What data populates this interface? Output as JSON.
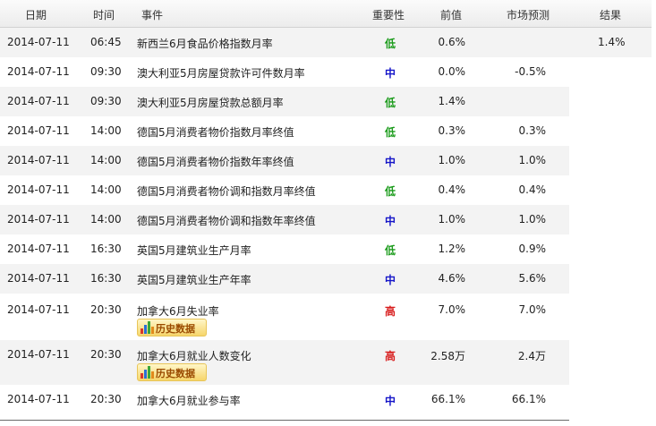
{
  "header": {
    "date": "日期",
    "time": "时间",
    "event": "事件",
    "importance": "重要性",
    "previous": "前值",
    "forecast": "市场预测",
    "result": "结果"
  },
  "history_button_label": "历史数据",
  "importance_colors": {
    "低": "#1b9b1b",
    "中": "#1515c8",
    "高": "#d81e1e"
  },
  "rows": [
    {
      "date": "2014-07-11",
      "time": "06:45",
      "event": "新西兰6月食品价格指数月率",
      "importance": "低",
      "previous": "0.6%",
      "forecast": "",
      "result": "1.4%"
    },
    {
      "date": "2014-07-11",
      "time": "09:30",
      "event": "澳大利亚5月房屋贷款许可件数月率",
      "importance": "中",
      "previous": "0.0%",
      "forecast": "-0.5%"
    },
    {
      "date": "2014-07-11",
      "time": "09:30",
      "event": "澳大利亚5月房屋贷款总额月率",
      "importance": "低",
      "previous": "1.4%",
      "forecast": ""
    },
    {
      "date": "2014-07-11",
      "time": "14:00",
      "event": "德国5月消费者物价指数月率终值",
      "importance": "低",
      "previous": "0.3%",
      "forecast": "0.3%"
    },
    {
      "date": "2014-07-11",
      "time": "14:00",
      "event": "德国5月消费者物价指数年率终值",
      "importance": "中",
      "previous": "1.0%",
      "forecast": "1.0%"
    },
    {
      "date": "2014-07-11",
      "time": "14:00",
      "event": "德国5月消费者物价调和指数月率终值",
      "importance": "低",
      "previous": "0.4%",
      "forecast": "0.4%"
    },
    {
      "date": "2014-07-11",
      "time": "14:00",
      "event": "德国5月消费者物价调和指数年率终值",
      "importance": "中",
      "previous": "1.0%",
      "forecast": "1.0%"
    },
    {
      "date": "2014-07-11",
      "time": "16:30",
      "event": "英国5月建筑业生产月率",
      "importance": "低",
      "previous": "1.2%",
      "forecast": "0.9%"
    },
    {
      "date": "2014-07-11",
      "time": "16:30",
      "event": "英国5月建筑业生产年率",
      "importance": "中",
      "previous": "4.6%",
      "forecast": "5.6%"
    },
    {
      "date": "2014-07-11",
      "time": "20:30",
      "event": "加拿大6月失业率",
      "importance": "高",
      "previous": "7.0%",
      "forecast": "7.0%",
      "history": true
    },
    {
      "date": "2014-07-11",
      "time": "20:30",
      "event": "加拿大6月就业人数变化",
      "importance": "高",
      "previous": "2.58万",
      "forecast": "2.4万",
      "history": true
    },
    {
      "date": "2014-07-11",
      "time": "20:30",
      "event": "加拿大6月就业参与率",
      "importance": "中",
      "previous": "66.1%",
      "forecast": "66.1%"
    }
  ]
}
